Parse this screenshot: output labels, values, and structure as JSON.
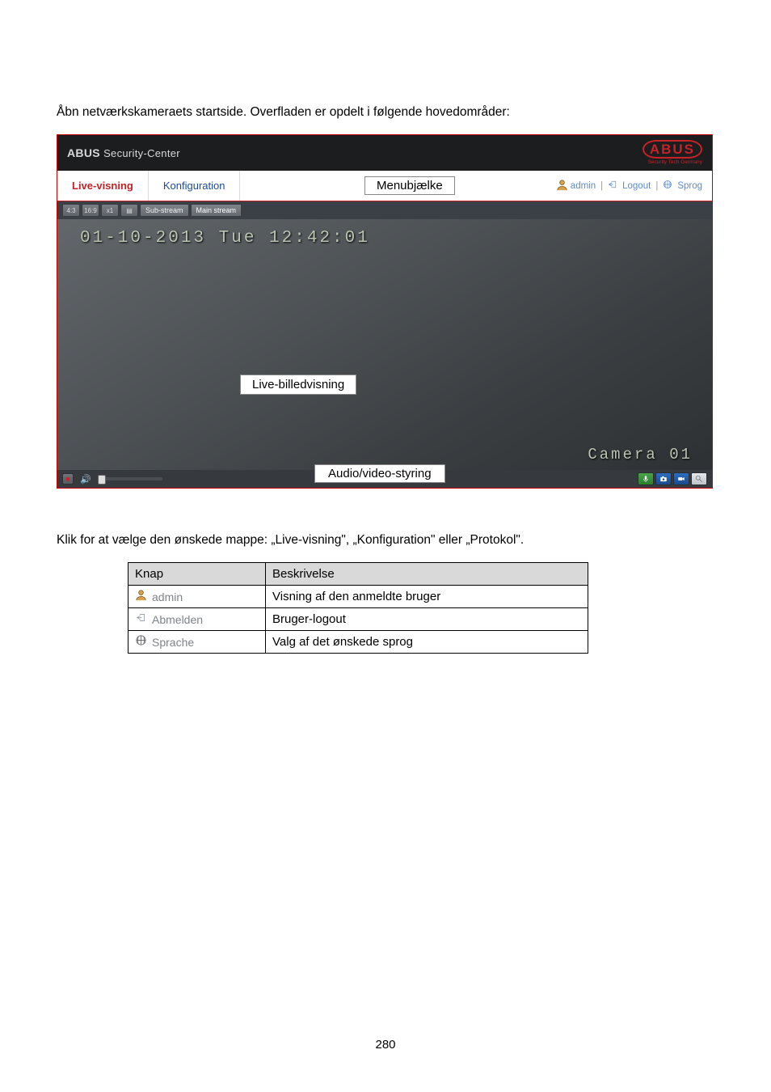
{
  "intro": "Åbn netværkskameraets startside. Overfladen er opdelt i følgende hovedområder:",
  "header": {
    "brand": "ABUS",
    "brand_sub": "Security-Center",
    "logo_text": "ABUS",
    "logo_sub": "Security Tech Germany"
  },
  "menu": {
    "tabs": [
      {
        "label": "Live-visning",
        "active": true
      },
      {
        "label": "Konfiguration",
        "active": false
      }
    ],
    "callout": "Menubjælke",
    "right": {
      "user_label": "admin",
      "logout_label": "Logout",
      "lang_label": "Sprog"
    }
  },
  "toolbar": {
    "btns": [
      "4:3",
      "16:9",
      "x1",
      "▤"
    ],
    "stream1": "Sub-stream",
    "stream2": "Main stream"
  },
  "camera": {
    "timestamp": "01-10-2013 Tue 12:42:01",
    "live_label": "Live-billedvisning",
    "camera_name": "Camera 01",
    "av_label": "Audio/video-styring"
  },
  "para2": "Klik for at vælge den ønskede mappe: „Live-visning\", „Konfiguration\" eller „Protokol\".",
  "table": {
    "headers": [
      "Knap",
      "Beskrivelse"
    ],
    "rows": [
      {
        "icon": "user",
        "label": "admin",
        "desc": "Visning af den anmeldte bruger"
      },
      {
        "icon": "logout",
        "label": "Abmelden",
        "desc": "Bruger-logout"
      },
      {
        "icon": "globe",
        "label": "Sprache",
        "desc": "Valg af det ønskede sprog"
      }
    ]
  },
  "page_number": "280"
}
